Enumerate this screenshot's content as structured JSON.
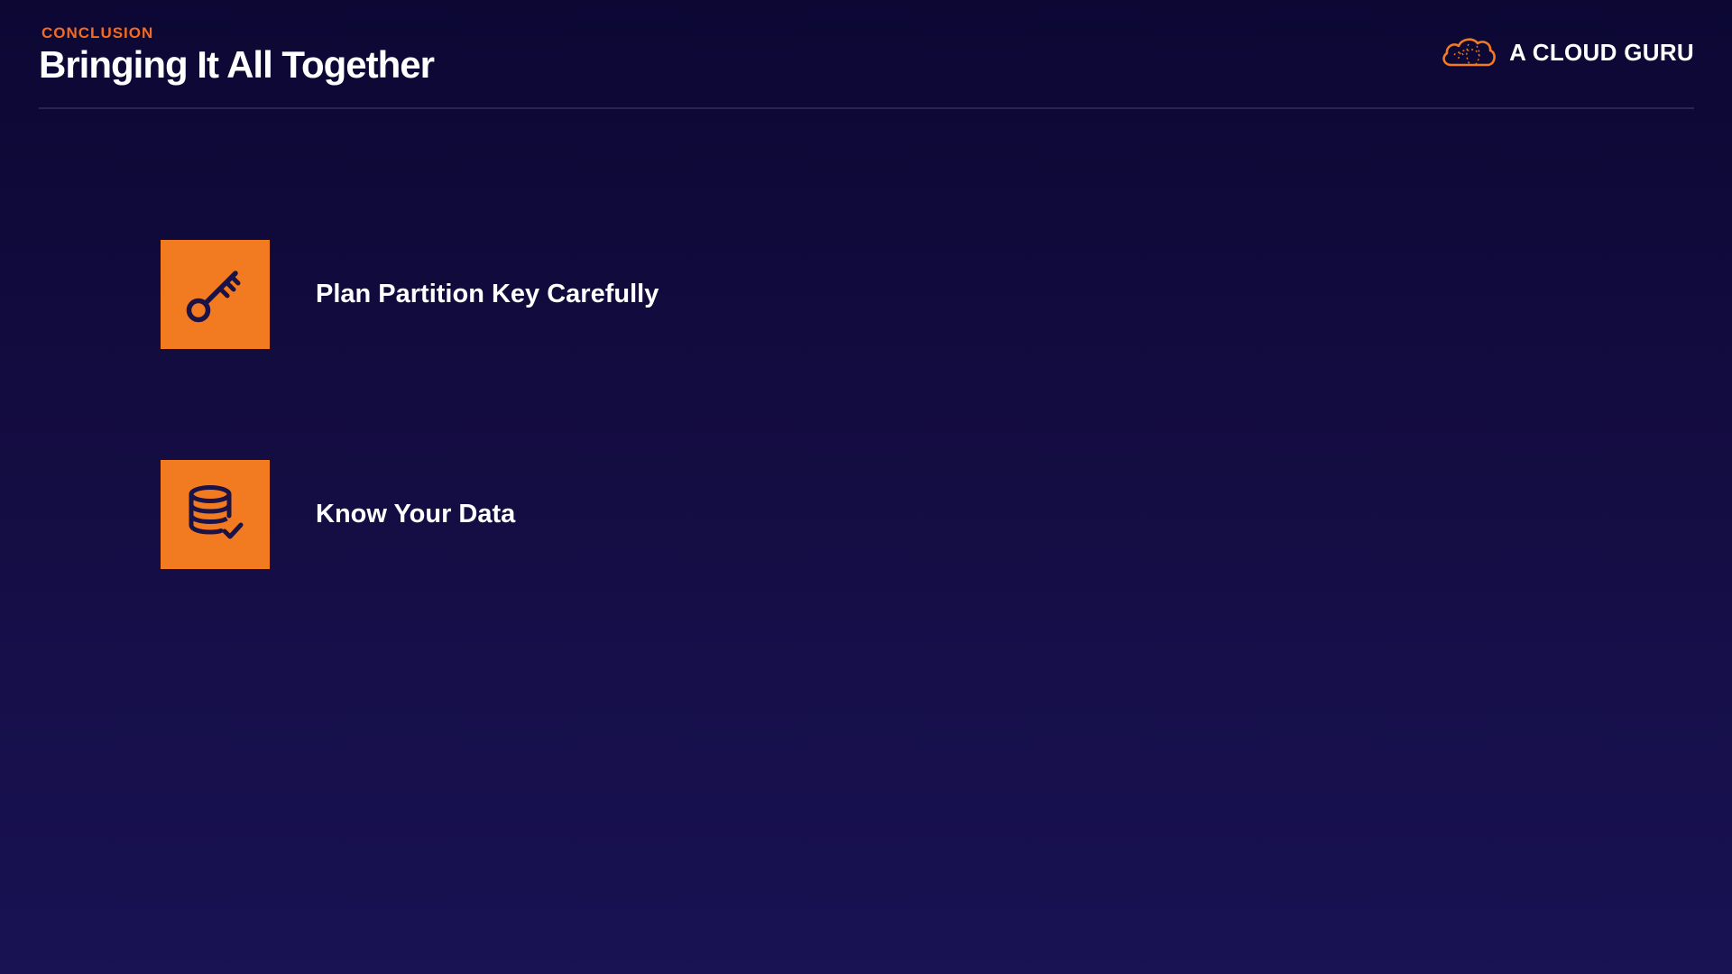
{
  "header": {
    "section_label": "CONCLUSION",
    "title": "Bringing It All Together"
  },
  "brand": {
    "name": "A CLOUD GURU",
    "logo_icon": "cloud-logo-icon"
  },
  "items": [
    {
      "label": "Plan Partition Key Carefully",
      "icon": "key-icon"
    },
    {
      "label": "Know Your Data",
      "icon": "database-check-icon"
    }
  ],
  "colors": {
    "accent": "#f27b21",
    "background_top": "#0c0733",
    "background_bottom": "#191253",
    "text": "#ffffff"
  }
}
